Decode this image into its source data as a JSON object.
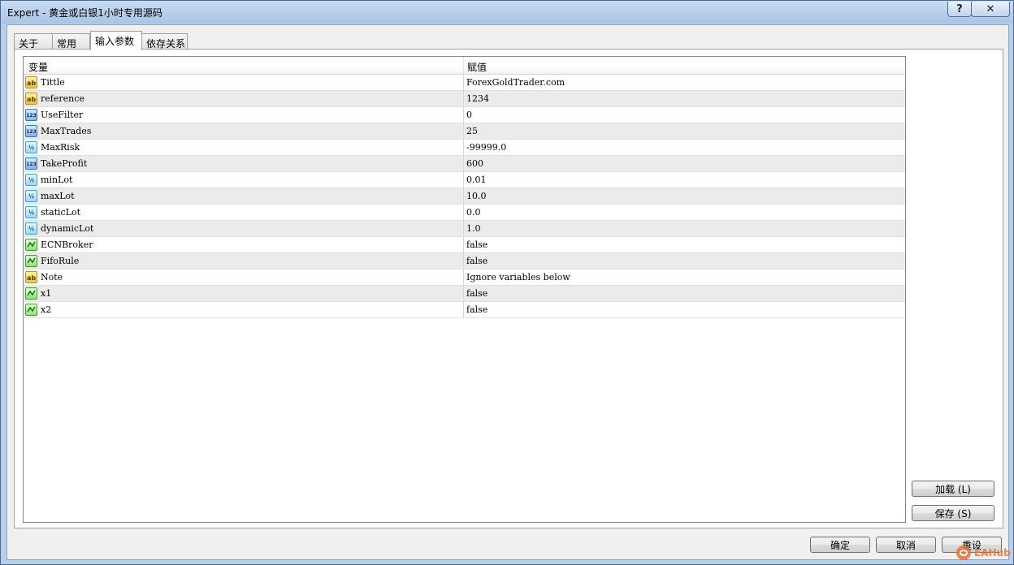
{
  "window": {
    "title": "Expert - 黄金或白银1小时专用源码",
    "help_label": "?",
    "close_label": "✕"
  },
  "tabs": [
    {
      "label": "关于",
      "active": false
    },
    {
      "label": "常用",
      "active": false
    },
    {
      "label": "输入参数",
      "active": true
    },
    {
      "label": "依存关系",
      "active": false
    }
  ],
  "grid": {
    "columns": {
      "variable": "变量",
      "value": "赋值"
    },
    "rows": [
      {
        "type": "ab",
        "icon": "string-type-icon",
        "name": "Tittle",
        "value": "ForexGoldTrader.com"
      },
      {
        "type": "ab",
        "icon": "string-type-icon",
        "name": "reference",
        "value": "1234"
      },
      {
        "type": "int",
        "icon": "integer-type-icon",
        "name": "UseFilter",
        "value": "0"
      },
      {
        "type": "int",
        "icon": "integer-type-icon",
        "name": "MaxTrades",
        "value": "25"
      },
      {
        "type": "dbl",
        "icon": "double-type-icon",
        "name": "MaxRisk",
        "value": "-99999.0"
      },
      {
        "type": "int",
        "icon": "integer-type-icon",
        "name": "TakeProfit",
        "value": "600"
      },
      {
        "type": "dbl",
        "icon": "double-type-icon",
        "name": "minLot",
        "value": "0.01"
      },
      {
        "type": "dbl",
        "icon": "double-type-icon",
        "name": "maxLot",
        "value": "10.0"
      },
      {
        "type": "dbl",
        "icon": "double-type-icon",
        "name": "staticLot",
        "value": "0.0"
      },
      {
        "type": "dbl",
        "icon": "double-type-icon",
        "name": "dynamicLot",
        "value": "1.0"
      },
      {
        "type": "bool",
        "icon": "boolean-type-icon",
        "name": "ECNBroker",
        "value": "false"
      },
      {
        "type": "bool",
        "icon": "boolean-type-icon",
        "name": "FifoRule",
        "value": "false"
      },
      {
        "type": "ab",
        "icon": "string-type-icon",
        "name": "Note",
        "value": "Ignore variables below"
      },
      {
        "type": "bool",
        "icon": "boolean-type-icon",
        "name": "x1",
        "value": "false"
      },
      {
        "type": "bool",
        "icon": "boolean-type-icon",
        "name": "x2",
        "value": "false"
      }
    ]
  },
  "icon_text": {
    "ab": "ab",
    "int": "123",
    "dbl": "½"
  },
  "side_buttons": {
    "load": "加载 (L)",
    "save": "保存 (S)"
  },
  "bottom_buttons": {
    "ok": "确定",
    "cancel": "取消",
    "reset": "重设"
  },
  "watermark": {
    "text": "EAHub"
  }
}
